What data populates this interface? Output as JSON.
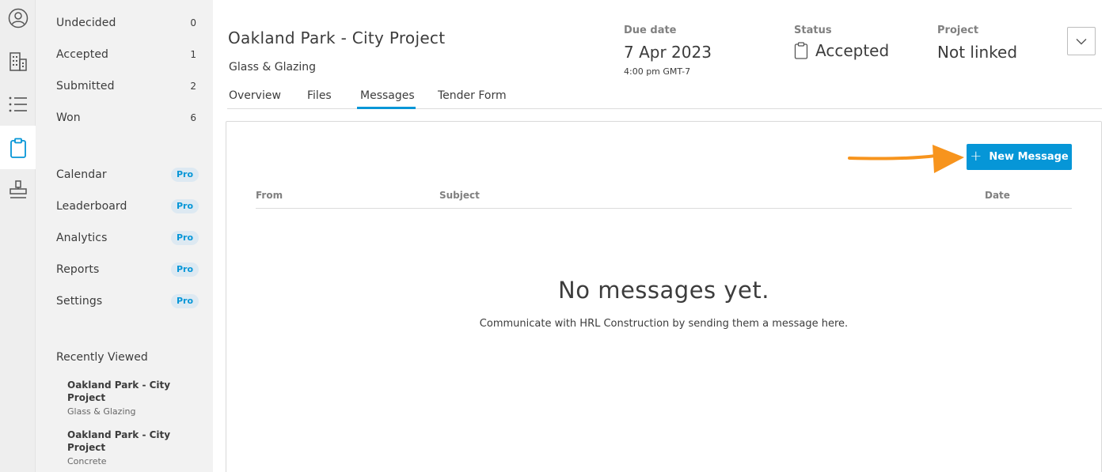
{
  "nav": {
    "bid_status": [
      {
        "label": "Undecided",
        "count": "0"
      },
      {
        "label": "Accepted",
        "count": "1"
      },
      {
        "label": "Submitted",
        "count": "2"
      },
      {
        "label": "Won",
        "count": "6"
      }
    ],
    "pro_items": [
      {
        "label": "Calendar",
        "badge": "Pro"
      },
      {
        "label": "Leaderboard",
        "badge": "Pro"
      },
      {
        "label": "Analytics",
        "badge": "Pro"
      },
      {
        "label": "Reports",
        "badge": "Pro"
      },
      {
        "label": "Settings",
        "badge": "Pro"
      }
    ],
    "recently_viewed_title": "Recently Viewed",
    "recent": [
      {
        "title": "Oakland Park - City Project",
        "trade": "Glass & Glazing"
      },
      {
        "title": "Oakland Park - City Project",
        "trade": "Concrete"
      }
    ]
  },
  "rail_icons": [
    "user-circle-icon",
    "building-icon",
    "list-icon",
    "clipboard-icon",
    "stamp-icon"
  ],
  "header": {
    "title": "Oakland Park - City Project",
    "trade": "Glass & Glazing",
    "due_label": "Due date",
    "due_value": "7 Apr 2023",
    "due_time": "4:00 pm GMT-7",
    "status_label": "Status",
    "status_value": "Accepted",
    "project_label": "Project",
    "project_value": "Not linked"
  },
  "tabs": [
    {
      "label": "Overview",
      "active": false
    },
    {
      "label": "Files",
      "active": false
    },
    {
      "label": "Messages",
      "active": true
    },
    {
      "label": "Tender Form",
      "active": false
    }
  ],
  "messages": {
    "new_button_icon": "+",
    "new_button_label": "New Message",
    "columns": {
      "from": "From",
      "subject": "Subject",
      "date": "Date"
    },
    "empty_title": "No messages yet.",
    "empty_body": "Communicate with HRL Construction by sending them a message here."
  },
  "colors": {
    "accent": "#0696d7",
    "annotation_arrow": "#f7941d",
    "sidebar_bg": "#f2f2f2",
    "rail_bg": "#eeeeee"
  }
}
